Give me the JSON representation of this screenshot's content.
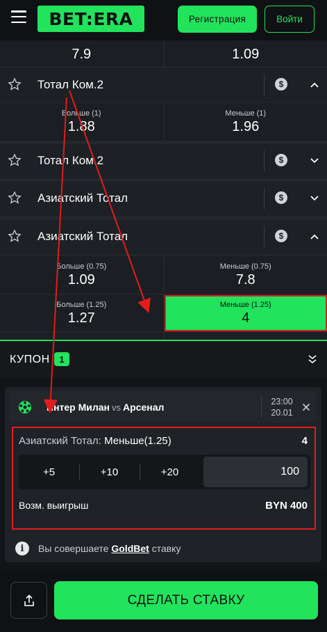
{
  "header": {
    "logo": "BET:ERA",
    "register_label": "Регистрация",
    "login_label": "Войти"
  },
  "odds_top": {
    "left_value": "7.9",
    "right_value": "1.09"
  },
  "markets": [
    {
      "name": "Тотал Ком.2",
      "expanded": true
    },
    {
      "name": "Тотал Ком.2",
      "expanded": false
    },
    {
      "name": "Азиатский Тотал",
      "expanded": false
    },
    {
      "name": "Азиатский Тотал",
      "expanded": true
    }
  ],
  "odds_total2": [
    {
      "label": "Больше (1)",
      "value": "1.88"
    },
    {
      "label": "Меньше (1)",
      "value": "1.96"
    }
  ],
  "odds_asian_1": [
    {
      "label": "Больше (0.75)",
      "value": "1.09"
    },
    {
      "label": "Меньше (0.75)",
      "value": "7.8"
    }
  ],
  "odds_asian_2": [
    {
      "label": "Больше (1.25)",
      "value": "1.27"
    },
    {
      "label": "Меньше (1.25)",
      "value": "4"
    }
  ],
  "coupon": {
    "title": "КУПОН",
    "count": "1",
    "match_home": "Интер Милан",
    "match_vs": "vs",
    "match_away": "Арсенал",
    "time": "23:00",
    "date": "20.01",
    "bet_market": "Азиатский Тотал:",
    "bet_pick": "Меньше(1.25)",
    "bet_odd": "4",
    "quick_stakes": [
      "+5",
      "+10",
      "+20"
    ],
    "stake_value": "100",
    "win_label": "Возм. выигрыш",
    "win_value": "BYN 400",
    "info_prefix": "Вы совершаете",
    "info_gold": "GoldBet",
    "info_suffix": "ставку"
  },
  "footer": {
    "place_bet_label": "СДЕЛАТЬ СТАВКУ"
  },
  "colors": {
    "accent": "#22e35c",
    "annotation": "#e11d1d",
    "bg": "#1a1d21"
  }
}
